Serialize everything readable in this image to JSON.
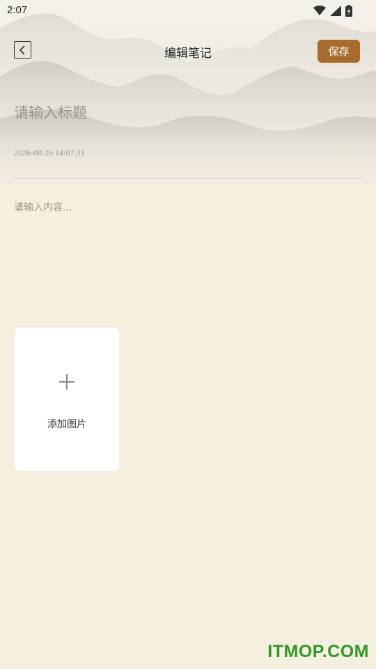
{
  "status_bar": {
    "time": "2:07",
    "icons": [
      "wifi-icon",
      "cell-signal-icon",
      "battery-charging-icon"
    ]
  },
  "app_bar": {
    "back_icon": "chevron-left-icon",
    "title": "编辑笔记",
    "save_label": "保存"
  },
  "editor": {
    "title_placeholder": "请输入标题",
    "title_value": "",
    "timestamp": "2026-08-26 14:07:31",
    "content_placeholder": "请输入内容...",
    "content_value": ""
  },
  "attachments": {
    "add_icon": "plus-icon",
    "add_label": "添加图片"
  },
  "watermark": "ITMOP.COM",
  "colors": {
    "accent": "#a86b2c",
    "background": "#f5efdf",
    "watermark": "#2e9a25"
  }
}
